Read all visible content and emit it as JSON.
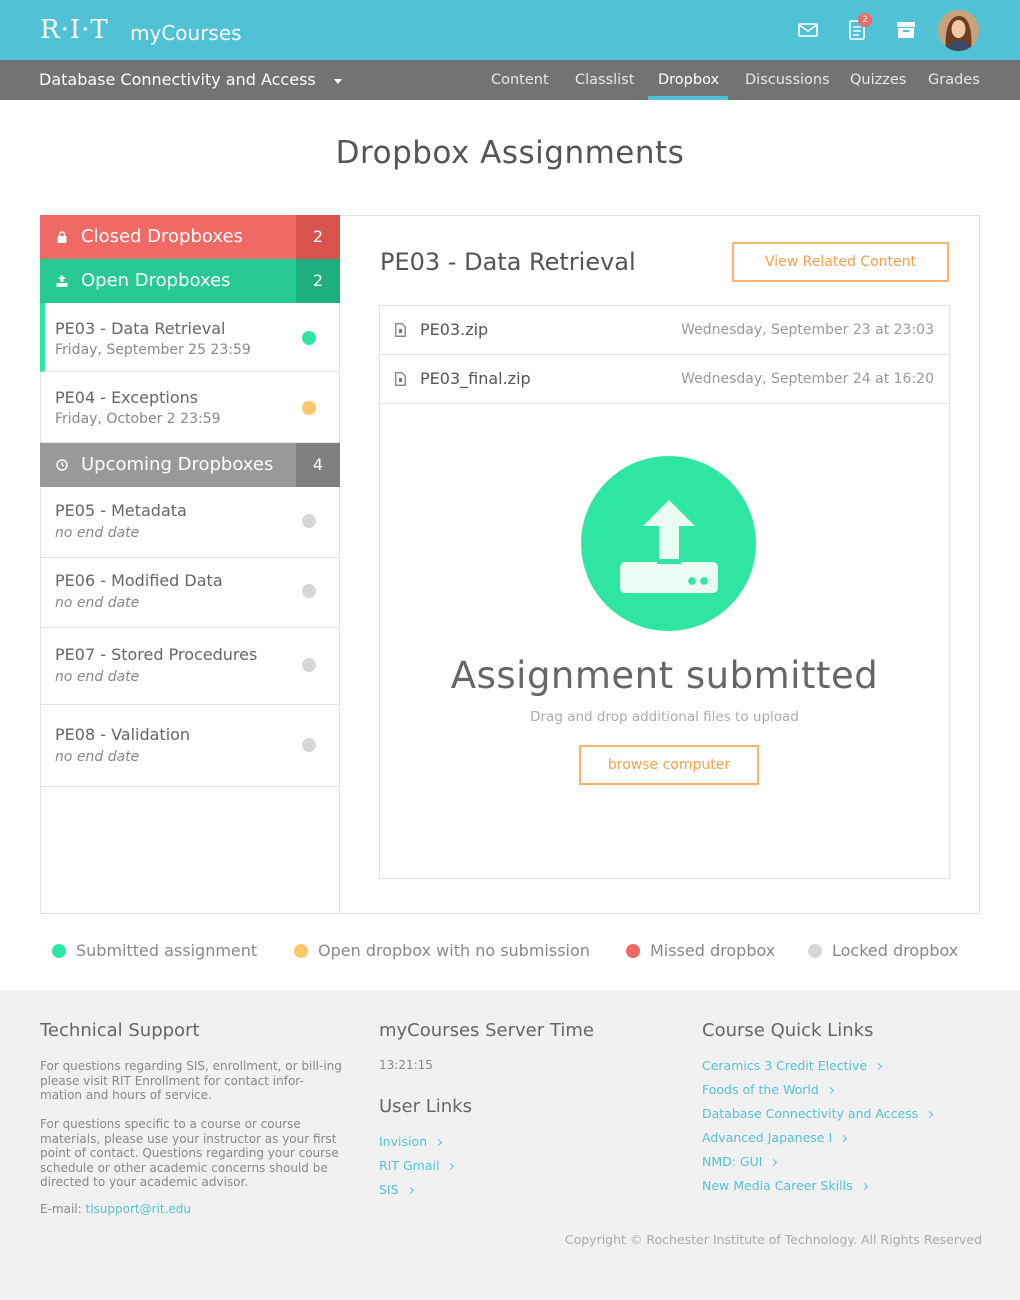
{
  "header": {
    "logo": "R·I·T",
    "app_name": "myCourses",
    "notification_count": "2",
    "icons": [
      "mail-icon",
      "document-icon",
      "archive-icon"
    ],
    "brand_color": "#51c2d5"
  },
  "nav": {
    "course_title": "Database Connectivity and Access",
    "tabs": [
      {
        "label": "Content",
        "active": false
      },
      {
        "label": "Classlist",
        "active": false
      },
      {
        "label": "Dropbox",
        "active": true
      },
      {
        "label": "Discussions",
        "active": false
      },
      {
        "label": "Quizzes",
        "active": false
      },
      {
        "label": "Grades",
        "active": false
      }
    ]
  },
  "page_title": "Dropbox Assignments",
  "sidebar": {
    "closed": {
      "label": "Closed Dropboxes",
      "count": "2",
      "color": "#ef6a64"
    },
    "open": {
      "label": "Open Dropboxes",
      "count": "2",
      "color": "#27c994",
      "items": [
        {
          "title": "PE03 - Data Retrieval",
          "subtitle": "Friday, September 25 23:59",
          "status": "submitted"
        },
        {
          "title": "PE04 - Exceptions",
          "subtitle": "Friday, October 2 23:59",
          "status": "open"
        }
      ]
    },
    "upcoming": {
      "label": "Upcoming Dropboxes",
      "count": "4",
      "color": "#999999",
      "items": [
        {
          "title": "PE05 - Metadata",
          "subtitle": "no end date",
          "status": "locked"
        },
        {
          "title": "PE06 - Modified Data",
          "subtitle": "no end date",
          "status": "locked"
        },
        {
          "title": "PE07 - Stored Procedures",
          "subtitle": "no end date",
          "status": "locked"
        },
        {
          "title": "PE08 - Validation",
          "subtitle": "no end date",
          "status": "locked"
        }
      ]
    }
  },
  "detail": {
    "title": "PE03 - Data Retrieval",
    "related_button": "View Related Content",
    "files": [
      {
        "name": "PE03.zip",
        "date": "Wednesday, September 23 at 23:03"
      },
      {
        "name": "PE03_final.zip",
        "date": "Wednesday, September 24 at 16:20"
      }
    ],
    "submitted_title": "Assignment submitted",
    "drag_text": "Drag and drop additional files to upload",
    "browse_button": "browse computer"
  },
  "legend": [
    {
      "label": "Submitted assignment",
      "color": "#2ee6a2"
    },
    {
      "label": "Open dropbox with no submission",
      "color": "#fbc86a"
    },
    {
      "label": "Missed dropbox",
      "color": "#ef6a64"
    },
    {
      "label": "Locked dropbox",
      "color": "#d6d6d6"
    }
  ],
  "footer": {
    "support": {
      "heading": "Technical Support",
      "para1": "For questions regarding SIS, enrollment, or bill-ing please visit RIT Enrollment for contact infor-mation and hours of service.",
      "para2": "For questions specific to a course or course materials, please use your instructor as your first point of contact. Questions regarding your course schedule or other academic concerns should be directed to your academic advisor.",
      "email_label": "E-mail:",
      "email": "tlsupport@rit.edu"
    },
    "server_time": {
      "heading": "myCourses Server Time",
      "value": "13:21:15"
    },
    "user_links": {
      "heading": "User Links",
      "links": [
        "Invision",
        "RIT Gmail",
        "SIS"
      ]
    },
    "quick_links": {
      "heading": "Course Quick Links",
      "links": [
        "Ceramics 3 Credit Elective",
        "Foods of the World",
        "Database Connectivity and Access",
        "Advanced Japanese I",
        "NMD: GUI",
        "New Media Career Skills"
      ]
    },
    "copyright": "Copyright © Rochester Institute of Technology. All Rights Reserved"
  }
}
